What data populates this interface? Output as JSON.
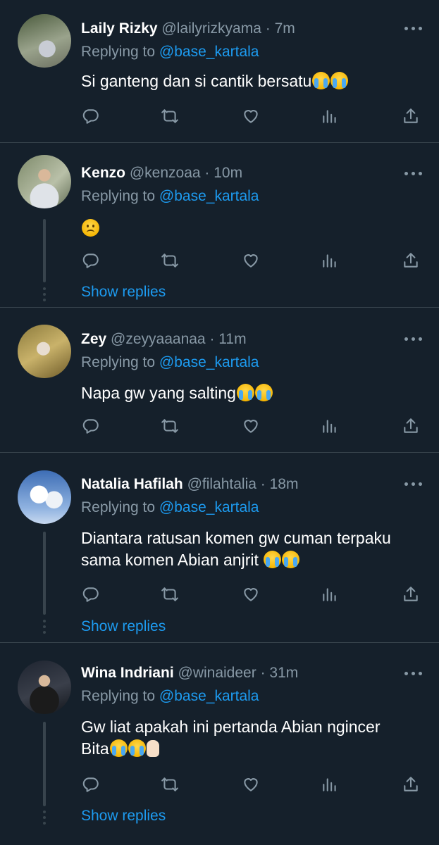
{
  "tweets": [
    {
      "name": "Laily Rizky",
      "handle": "@lailyrizkyama",
      "separator": "·",
      "time": "7m",
      "replying_prefix": "Replying to",
      "replying_to": "@base_kartala",
      "text_line1": "Si ganteng dan si cantik bersatu",
      "text_line2": "",
      "emojis": [
        "crying",
        "crying"
      ],
      "show_replies": ""
    },
    {
      "name": "Kenzo",
      "handle": "@kenzoaa",
      "separator": "·",
      "time": "10m",
      "replying_prefix": "Replying to",
      "replying_to": "@base_kartala",
      "text_line1": "",
      "text_line2": "",
      "emojis": [
        "frowning"
      ],
      "show_replies": "Show replies"
    },
    {
      "name": "Zey",
      "handle": "@zeyyaaanaa",
      "separator": "·",
      "time": "11m",
      "replying_prefix": "Replying to",
      "replying_to": "@base_kartala",
      "text_line1": "Napa gw yang salting",
      "text_line2": "",
      "emojis": [
        "crying",
        "crying"
      ],
      "show_replies": ""
    },
    {
      "name": "Natalia Hafilah",
      "handle": "@filahtalia",
      "separator": "·",
      "time": "18m",
      "replying_prefix": "Replying to",
      "replying_to": "@base_kartala",
      "text_line1": "Diantara ratusan komen gw cuman terpaku",
      "text_line2": "sama komen Abian anjrit ",
      "emojis": [
        "crying",
        "crying"
      ],
      "show_replies": "Show replies"
    },
    {
      "name": "Wina Indriani",
      "handle": "@winaideer",
      "separator": "·",
      "time": "31m",
      "replying_prefix": "Replying to",
      "replying_to": "@base_kartala",
      "text_line1": "Gw liat apakah ini pertanda Abian ngincer",
      "text_line2": "Bita",
      "emojis": [
        "crying",
        "crying",
        "pointing-up"
      ],
      "show_replies": "Show replies"
    }
  ],
  "icons": {
    "reply": "reply-icon",
    "retweet": "retweet-icon",
    "like": "heart-icon",
    "views": "views-icon",
    "share": "share-icon",
    "more": "more-icon"
  },
  "colors": {
    "background": "#15202b",
    "text": "#ffffff",
    "secondary": "#8899a6",
    "link": "#1d9bf0",
    "divider": "#38444d"
  }
}
